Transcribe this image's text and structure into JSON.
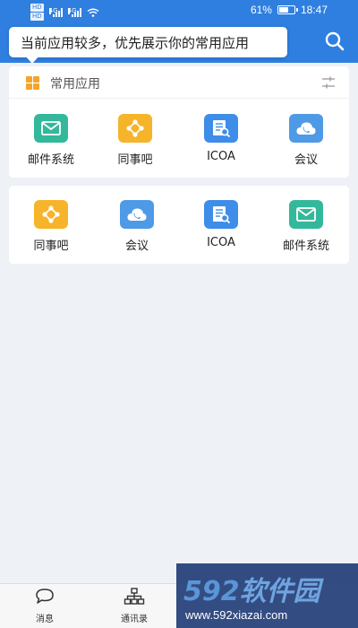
{
  "status_bar": {
    "battery": "61%",
    "time": "18:47"
  },
  "tooltip": {
    "text": "当前应用较多，优先展示你的常用应用"
  },
  "common_apps": {
    "title": "常用应用",
    "items": [
      {
        "label": "邮件系统",
        "icon": "mail-icon"
      },
      {
        "label": "同事吧",
        "icon": "share-icon"
      },
      {
        "label": "ICOA",
        "icon": "document-search-icon"
      },
      {
        "label": "会议",
        "icon": "cloud-phone-icon"
      }
    ]
  },
  "all_apps": {
    "items": [
      {
        "label": "同事吧",
        "icon": "share-icon"
      },
      {
        "label": "会议",
        "icon": "cloud-phone-icon"
      },
      {
        "label": "ICOA",
        "icon": "document-search-icon"
      },
      {
        "label": "邮件系统",
        "icon": "mail-icon"
      }
    ]
  },
  "bottom_nav": [
    {
      "label": "消息",
      "icon": "chat-bubble-icon"
    },
    {
      "label": "通讯录",
      "icon": "org-chart-icon"
    }
  ],
  "watermark": {
    "logo_digits": "592",
    "logo_text": "软件园",
    "url": "www.592xiazai.com"
  },
  "colors": {
    "header": "#2f7fe0",
    "mail": "#34b89b",
    "share": "#f6b42a",
    "doc": "#3e8de8",
    "meeting": "#4f9ae6"
  }
}
